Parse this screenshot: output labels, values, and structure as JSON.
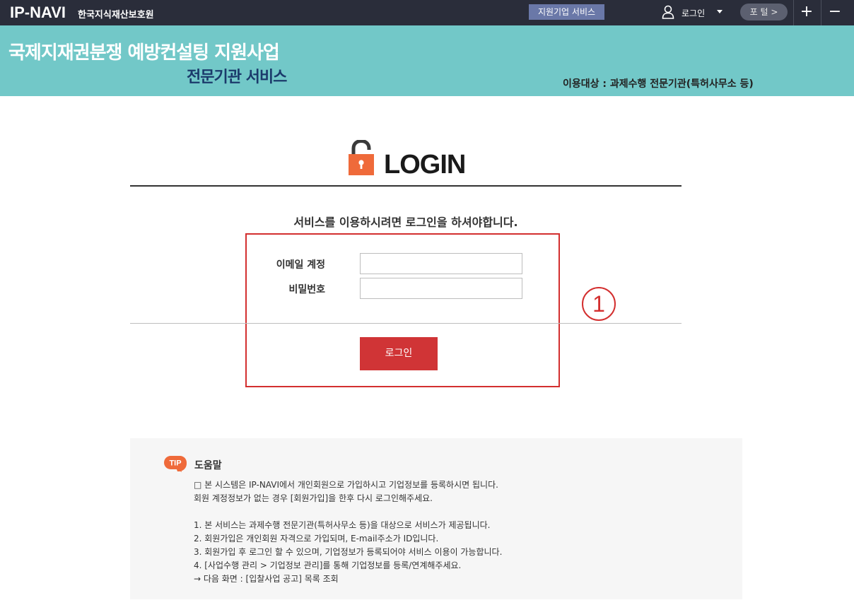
{
  "topbar": {
    "logo": "IP-NAVI",
    "org": "한국지식재산보호원",
    "service_button": "지원기업 서비스",
    "login_menu": "로그인",
    "portal_button": "포 털 >",
    "plus_icon": "+",
    "minus_icon": "−"
  },
  "banner": {
    "title": "국제지재권분쟁 예방컨설팅 지원사업",
    "subtitle": "전문기관 서비스",
    "target": "이용대상 : 과제수행 전문기관(특허사무소 등)"
  },
  "login": {
    "title": "LOGIN",
    "notice": "서비스를 이용하시려면 로그인을 하셔야합니다.",
    "email_label": "이메일 계정",
    "email_value": "",
    "password_label": "비밀번호",
    "password_value": "",
    "button": "로그인",
    "annotation_number": "1"
  },
  "help": {
    "tip_badge": "TIP",
    "title": "도움말",
    "lines": [
      "□ 본 시스템은 IP-NAVI에서 개인회원으로 가입하시고 기업정보를 등록하시면 됩니다.",
      "회원 계정정보가 없는 경우 [회원가입]을 한후 다시 로그인해주세요.",
      "1. 본 서비스는 과제수행 전문기관(특허사무소 등)을 대상으로 서비스가 제공됩니다.",
      "2. 회원가입은 개인회원 자격으로 가입되며, E-mail주소가 ID입니다.",
      "3. 회원가입 후 로그인 할 수 있으며, 기업정보가 등록되어야 서비스 이용이 가능합니다.",
      "4. [사업수행 관리 > 기업정보 관리]를 통해 기업정보를 등록/연계해주세요.",
      "→ 다음 화면 : [입찰사업 공고] 목록 조회"
    ]
  },
  "colors": {
    "topbar": "#2a2d3a",
    "banner": "#72c8c8",
    "accent_red": "#d03436",
    "lock_orange": "#ef6a3a"
  }
}
